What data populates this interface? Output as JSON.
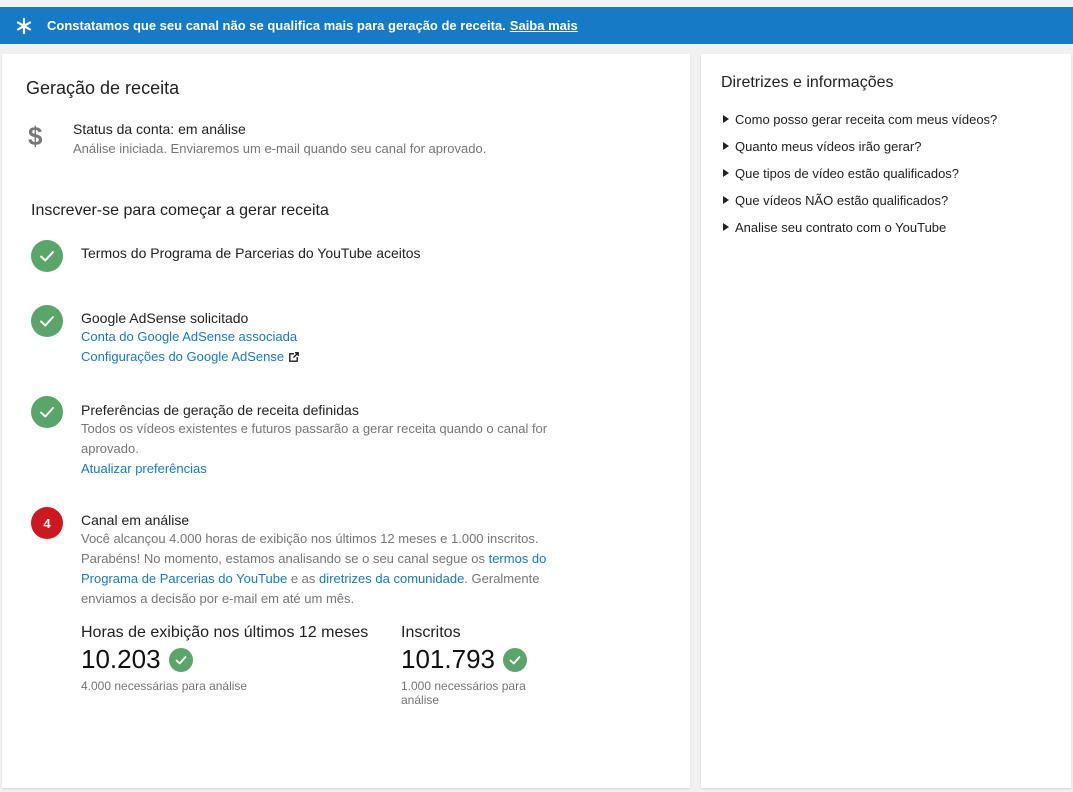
{
  "banner": {
    "message": "Constatamos que seu canal não se qualifica mais para geração de receita.",
    "link": "Saiba mais",
    "icon": "asterisk-icon",
    "color": "#167ac6"
  },
  "left": {
    "title": "Geração de receita",
    "status": {
      "icon": "dollar-icon",
      "main": "Status da conta: em análise",
      "sub": "Análise iniciada. Enviaremos um e-mail quando seu canal for aprovado."
    },
    "subhead": "Inscrever-se para começar a gerar receita",
    "steps": [
      {
        "title": "Termos do Programa de Parcerias do YouTube aceitos"
      },
      {
        "title": "Google AdSense solicitado",
        "link1": "Conta do Google AdSense associada",
        "link2": "Configurações do Google AdSense"
      },
      {
        "title": "Preferências de geração de receita definidas",
        "body": "Todos os vídeos existentes e futuros passarão a gerar receita quando o canal for aprovado.",
        "link": "Atualizar preferências"
      },
      {
        "number": "4",
        "title": "Canal em análise",
        "body1": "Você alcançou 4.000 horas de exibição nos últimos 12 meses e 1.000 inscritos. Parabéns! No momento, estamos analisando se o seu canal segue os",
        "link1": "termos do Programa de Parcerias do YouTube",
        "body2": "e as",
        "link2": "diretrizes da comunidade",
        "body3": ". Geralmente enviamos a decisão por e-mail em até um mês."
      }
    ],
    "metrics": {
      "hours": {
        "label": "Horas de exibição nos últimos 12 meses",
        "value": "10.203",
        "note": "4.000 necessárias para análise"
      },
      "subs": {
        "label": "Inscritos",
        "value": "101.793",
        "note": "1.000 necessários para análise"
      }
    }
  },
  "right": {
    "title": "Diretrizes e informações",
    "items": [
      "Como posso gerar receita com meus vídeos?",
      "Quanto meus vídeos irão gerar?",
      "Que tipos de vídeo estão qualificados?",
      "Que vídeos NÃO estão qualificados?",
      "Analise seu contrato com o YouTube"
    ]
  },
  "colors": {
    "accent": "#167ac6",
    "success": "#5aa56a",
    "alert": "#cc181e"
  }
}
